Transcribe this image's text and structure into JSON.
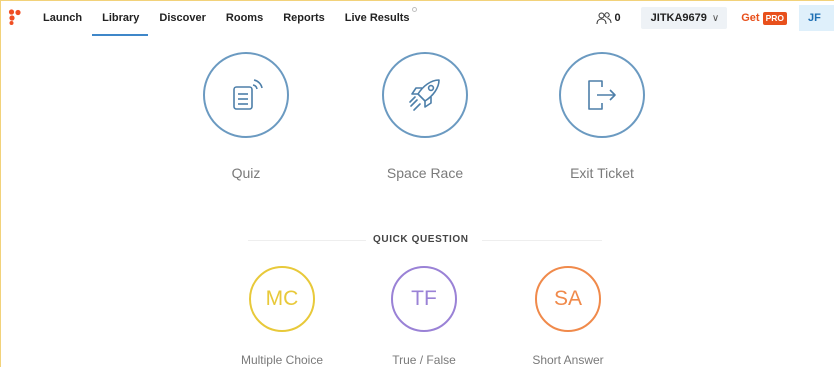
{
  "nav": {
    "items": [
      {
        "label": "Launch"
      },
      {
        "label": "Library"
      },
      {
        "label": "Discover"
      },
      {
        "label": "Rooms"
      },
      {
        "label": "Reports"
      },
      {
        "label": "Live Results"
      }
    ],
    "active": "Library"
  },
  "header": {
    "users_count": "0",
    "account_name": "JITKA9679",
    "account_chevron": "∨",
    "get_label": "Get",
    "pro_label": "PRO",
    "initials": "JF"
  },
  "activities": [
    {
      "label": "Quiz",
      "icon": "quiz-document-icon"
    },
    {
      "label": "Space Race",
      "icon": "rocket-icon"
    },
    {
      "label": "Exit Ticket",
      "icon": "exit-door-icon"
    }
  ],
  "quick_question": {
    "title": "QUICK QUESTION",
    "items": [
      {
        "abbr": "MC",
        "label": "Multiple Choice",
        "color": "#e8c93a"
      },
      {
        "abbr": "TF",
        "label": "True / False",
        "color": "#9a82d6"
      },
      {
        "abbr": "SA",
        "label": "Short Answer",
        "color": "#f08a4b"
      }
    ]
  },
  "colors": {
    "accent": "#3f87c9",
    "activity_circle": "#6b9ac1",
    "pro": "#e8501c"
  }
}
